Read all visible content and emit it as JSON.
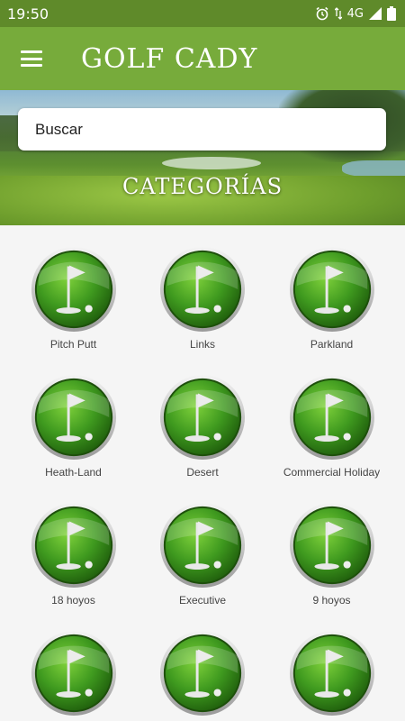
{
  "status_bar": {
    "time": "19:50",
    "network": "4G"
  },
  "app_bar": {
    "title": "GOLF CADY"
  },
  "search": {
    "placeholder": "Buscar"
  },
  "hero": {
    "heading": "CATEGORÍAS"
  },
  "categories": [
    {
      "label": "Pitch Putt",
      "icon": "golf-flag-icon"
    },
    {
      "label": "Links",
      "icon": "golf-flag-icon"
    },
    {
      "label": "Parkland",
      "icon": "golf-flag-icon"
    },
    {
      "label": "Heath-Land",
      "icon": "golf-flag-icon"
    },
    {
      "label": "Desert",
      "icon": "golf-flag-icon"
    },
    {
      "label": "Commercial Holiday",
      "icon": "golf-flag-icon"
    },
    {
      "label": "18 hoyos",
      "icon": "golf-flag-icon"
    },
    {
      "label": "Executive",
      "icon": "golf-flag-icon"
    },
    {
      "label": "9 hoyos",
      "icon": "golf-flag-icon"
    },
    {
      "label": "",
      "icon": "golf-flag-icon"
    },
    {
      "label": "",
      "icon": "golf-flag-icon"
    },
    {
      "label": "",
      "icon": "golf-flag-icon"
    }
  ],
  "colors": {
    "status_bar": "#5f8a2a",
    "app_bar": "#77ab3b",
    "icon_green": "#3f9a1f",
    "background": "#f5f5f5"
  }
}
